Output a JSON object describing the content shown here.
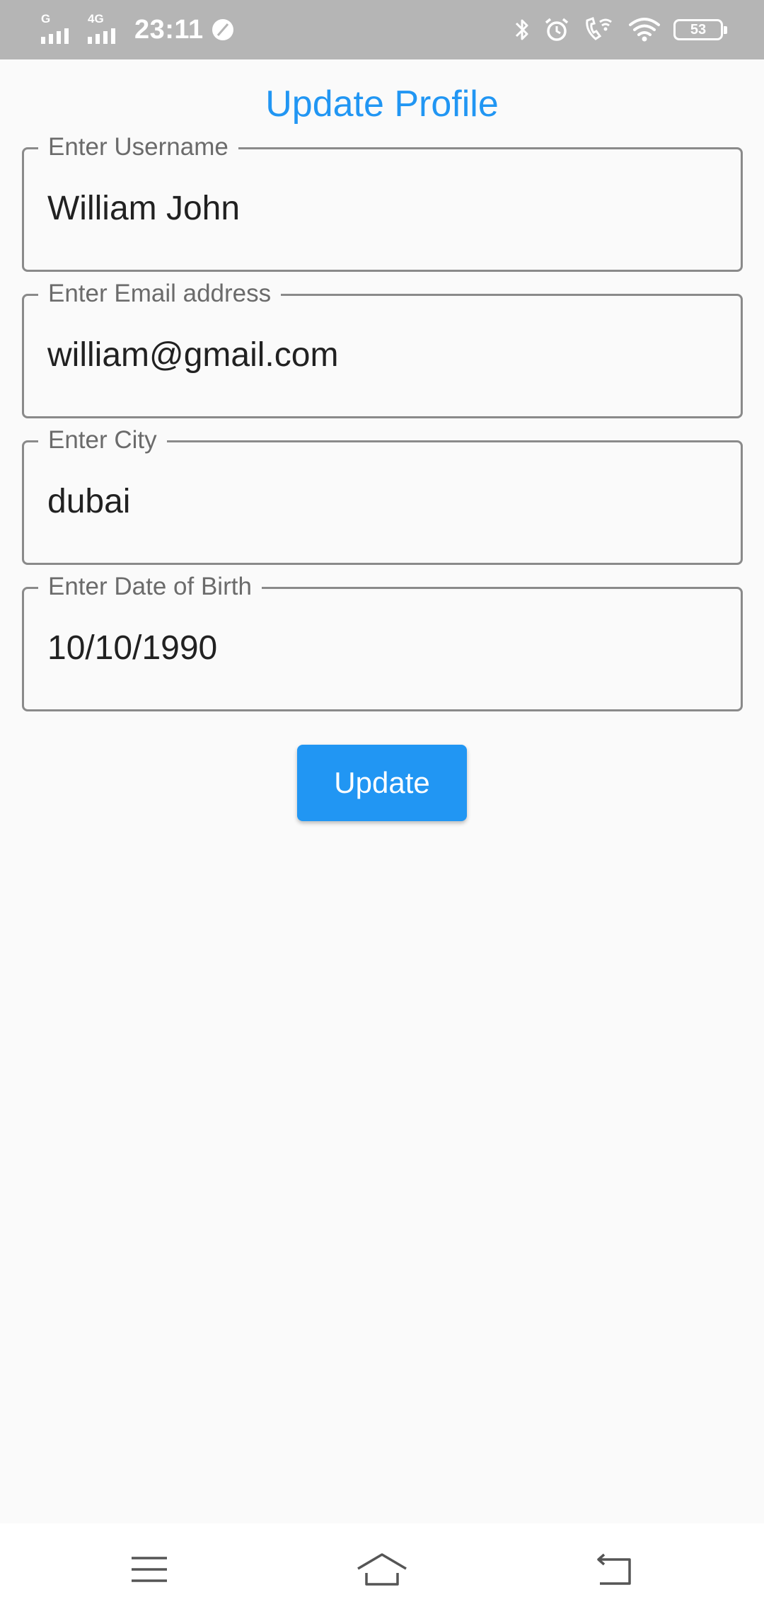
{
  "status_bar": {
    "sim1_label": "G",
    "sim2_label": "4G",
    "time": "23:11",
    "battery_level": "53",
    "icons": [
      "signal-icon",
      "signal-4g-icon",
      "leaf-icon",
      "bluetooth-icon",
      "alarm-icon",
      "wifi-calling-icon",
      "wifi-icon",
      "battery-icon"
    ]
  },
  "page": {
    "title": "Update Profile"
  },
  "form": {
    "username": {
      "label": "Enter Username",
      "value": "William John"
    },
    "email": {
      "label": "Enter Email address",
      "value": "william@gmail.com"
    },
    "city": {
      "label": "Enter City",
      "value": "dubai"
    },
    "dob": {
      "label": "Enter Date of Birth",
      "value": "10/10/1990"
    },
    "submit_label": "Update"
  },
  "navigation": {
    "items": [
      "menu-icon",
      "home-icon",
      "back-icon"
    ]
  },
  "colors": {
    "accent": "#2196f3",
    "status_bar": "#b5b5b5",
    "background": "#fafafa"
  }
}
